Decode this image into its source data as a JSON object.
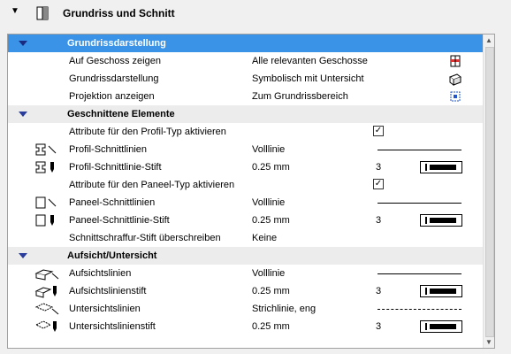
{
  "header": {
    "expand_icon": "triangle-down-icon",
    "panel_icon": "section-settings-icon",
    "title": "Grundriss und Schnitt"
  },
  "sections": [
    {
      "title": "Grundrissdarstellung",
      "selected": true,
      "rows": [
        {
          "label": "Auf Geschoss zeigen",
          "value": "Alle relevanten Geschosse",
          "icon": "stories-icon"
        },
        {
          "label": "Grundrissdarstellung",
          "value": "Symbolisch mit Untersicht",
          "icon": "projection-icon"
        },
        {
          "label": "Projektion anzeigen",
          "value": "Zum Grundrissbereich",
          "icon": "range-icon"
        }
      ]
    },
    {
      "title": "Geschnittene Elemente",
      "rows": [
        {
          "label": "Attribute für den Profil-Typ aktivieren",
          "checked": true
        },
        {
          "label": "Profil-Schnittlinien",
          "value": "Volllinie",
          "line": "solid",
          "icon": "profile-cut-line-icon"
        },
        {
          "label": "Profil-Schnittlinie-Stift",
          "value": "0.25 mm",
          "pen": "3",
          "icon": "profile-pen-icon"
        },
        {
          "label": "Attribute für den Paneel-Typ aktivieren",
          "checked": true
        },
        {
          "label": "Paneel-Schnittlinien",
          "value": "Volllinie",
          "line": "solid",
          "icon": "panel-cut-line-icon"
        },
        {
          "label": "Paneel-Schnittlinie-Stift",
          "value": "0.25 mm",
          "pen": "3",
          "icon": "panel-pen-icon"
        },
        {
          "label": "Schnittschraffur-Stift überschreiben",
          "value": "Keine"
        }
      ]
    },
    {
      "title": "Aufsicht/Untersicht",
      "rows": [
        {
          "label": "Aufsichtslinien",
          "value": "Volllinie",
          "line": "solid",
          "icon": "overhead-line-icon"
        },
        {
          "label": "Aufsichtslinienstift",
          "value": "0.25 mm",
          "pen": "3",
          "icon": "overhead-pen-icon"
        },
        {
          "label": "Untersichtslinien",
          "value": "Strichlinie, eng",
          "line": "dashed",
          "icon": "uncut-line-icon"
        },
        {
          "label": "Untersichtslinienstift",
          "value": "0.25 mm",
          "pen": "3",
          "icon": "uncut-pen-icon"
        }
      ]
    }
  ],
  "colors": {
    "selected_row": "#3a93e6",
    "section_row": "#ececec"
  }
}
